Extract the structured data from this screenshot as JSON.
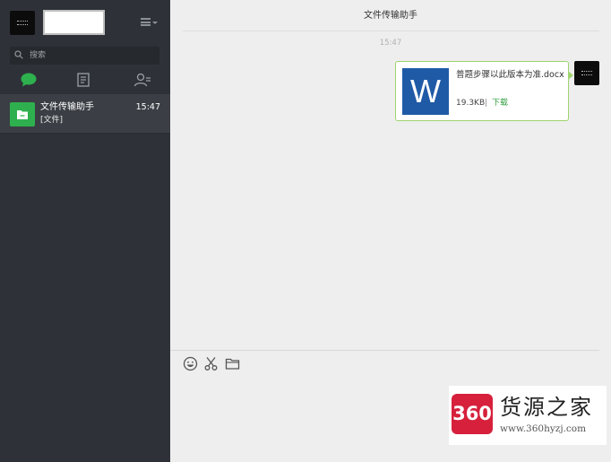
{
  "colors": {
    "sidebar_bg": "#2e3238",
    "selected_item_bg": "#3b3f45",
    "accent_green": "#2eb04e",
    "bubble_border": "#9ed46c",
    "word_blue": "#1f5aa6",
    "watermark_red": "#d6203c"
  },
  "sidebar": {
    "search": {
      "placeholder": "搜索",
      "icon": "search-icon"
    },
    "tabs": [
      {
        "icon": "chat-bubble-icon",
        "active": true
      },
      {
        "icon": "contacts-book-icon",
        "active": false
      },
      {
        "icon": "contacts-person-icon",
        "active": false
      }
    ],
    "chats": [
      {
        "name": "文件传输助手",
        "time": "15:47",
        "preview": "[文件]",
        "icon": "folder-icon"
      }
    ]
  },
  "conversation": {
    "title": "文件传输助手",
    "messages": [
      {
        "time": "15:47",
        "type": "file",
        "file_icon_letter": "W",
        "file_name": "普题步骤以此版本为准.docx",
        "file_size": "19.3KB",
        "separator": "|",
        "action_label": "下载"
      }
    ]
  },
  "toolbar": {
    "icons": [
      "emoji-icon",
      "scissors-icon",
      "folder-icon"
    ]
  },
  "watermark": {
    "badge": "360",
    "title": "货源之家",
    "url": "www.360hyzj.com"
  }
}
